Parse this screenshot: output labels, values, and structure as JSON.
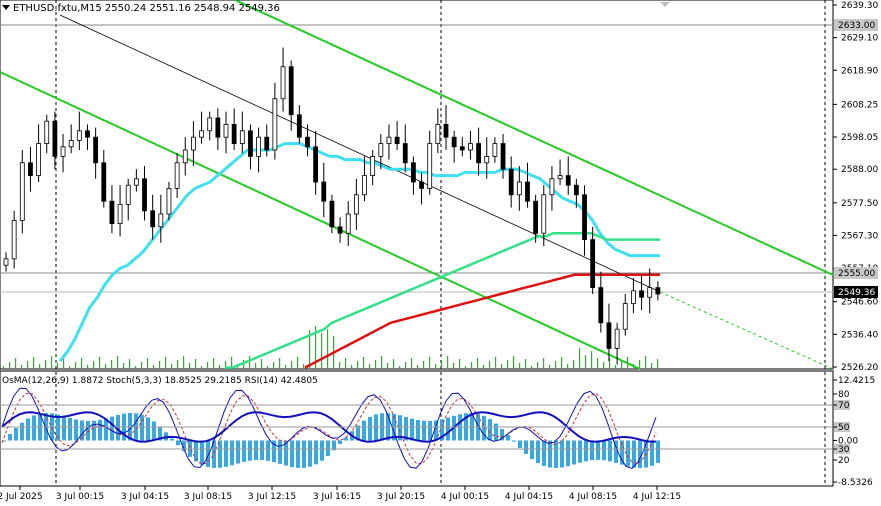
{
  "chart": {
    "symbol": "ETHUSD.fxtu,M15",
    "ohlc": "2550.24 2551.16 2548.94 2549.36",
    "bid_price": "2549.36",
    "level_price": "2555.00",
    "high_level_price": "2633.00",
    "colors": {
      "ema_fast": "#3fe0f0",
      "ema_mid": "#33e08a",
      "ema_slow": "#e01010",
      "channel": "#22cc22",
      "trend": "#000000",
      "candle": "#000000",
      "osma": "#39a8e0",
      "stoch_main": "#1010c0",
      "stoch_signal": "#d03030",
      "rsi": "#1010c0"
    }
  },
  "indicator": {
    "label": "OsMA(12,26,9) 1.8872  Stoch(5,3,3) 18.8525 29.2185  RSI(14) 42.4805"
  },
  "chart_data": [
    {
      "type": "line",
      "title": "ETHUSD.fxtu,M15",
      "xlabel": "",
      "ylabel": "",
      "y_ticks": [
        "2639.30",
        "2629.10",
        "2618.90",
        "2608.25",
        "2598.05",
        "2588.00",
        "2577.50",
        "2567.30",
        "2557.10",
        "2546.60",
        "2536.40",
        "2526.20"
      ],
      "x_ticks": [
        "2 Jul 2025",
        "3 Jul 00:15",
        "3 Jul 04:15",
        "3 Jul 08:15",
        "3 Jul 12:15",
        "3 Jul 16:15",
        "3 Jul 20:15",
        "4 Jul 00:15",
        "4 Jul 04:15",
        "4 Jul 08:15",
        "4 Jul 12:15"
      ],
      "ylim": [
        2526.2,
        2639.3
      ],
      "close": [
        2560,
        2572,
        2590,
        2586,
        2596,
        2603,
        2592,
        2595,
        2597,
        2600,
        2598,
        2590,
        2578,
        2571,
        2577,
        2583,
        2585,
        2575,
        2570,
        2574,
        2582,
        2590,
        2594,
        2598,
        2600,
        2604,
        2598,
        2602,
        2596,
        2600,
        2592,
        2598,
        2594,
        2610,
        2620,
        2605,
        2598,
        2595,
        2584,
        2578,
        2570,
        2568,
        2574,
        2580,
        2586,
        2592,
        2596,
        2598,
        2596,
        2590,
        2584,
        2582,
        2596,
        2602,
        2598,
        2595,
        2594,
        2596,
        2590,
        2592,
        2596,
        2588,
        2580,
        2584,
        2578,
        2568,
        2580,
        2585,
        2586,
        2583,
        2580,
        2566,
        2551,
        2540,
        2532,
        2538,
        2546,
        2550,
        2548,
        2551,
        2549
      ],
      "ema_fast": [
        2528,
        2531,
        2535,
        2540,
        2545,
        2548,
        2552,
        2555,
        2557,
        2558,
        2560,
        2562,
        2565,
        2568,
        2571,
        2574,
        2577,
        2580,
        2582,
        2583,
        2584,
        2586,
        2588,
        2590,
        2592,
        2594,
        2594,
        2594,
        2594,
        2595,
        2596,
        2596,
        2596,
        2595,
        2594,
        2593,
        2592,
        2592,
        2591,
        2591,
        2591,
        2590,
        2590,
        2589,
        2588,
        2588,
        2588,
        2588,
        2587,
        2587,
        2586,
        2586,
        2586,
        2586,
        2587,
        2587,
        2587,
        2587,
        2587,
        2588,
        2588,
        2588,
        2587,
        2586,
        2585,
        2583,
        2581,
        2579,
        2578,
        2577,
        2575,
        2572,
        2568,
        2565,
        2563,
        2562,
        2561,
        2561,
        2561,
        2561,
        2561
      ],
      "ema_mid": [
        2526,
        2526,
        2527,
        2528,
        2529,
        2530,
        2531,
        2532,
        2533,
        2534,
        2535,
        2536,
        2537,
        2538,
        2540,
        2541,
        2542,
        2543,
        2544,
        2545,
        2546,
        2547,
        2548,
        2549,
        2550,
        2551,
        2552,
        2553,
        2554,
        2555,
        2556,
        2557,
        2558,
        2559,
        2560,
        2561,
        2562,
        2563,
        2564,
        2565,
        2566,
        2567,
        2567,
        2568,
        2568,
        2568,
        2568,
        2568,
        2568,
        2567,
        2566,
        2566,
        2566,
        2566,
        2566,
        2566,
        2566,
        2566
      ],
      "ema_slow": [
        2526,
        2528,
        2530,
        2532,
        2534,
        2536,
        2538,
        2540,
        2541,
        2542,
        2543,
        2544,
        2545,
        2546,
        2547,
        2548,
        2549,
        2550,
        2551,
        2552,
        2553,
        2554,
        2555,
        2555,
        2555,
        2555,
        2555,
        2555,
        2555,
        2555
      ]
    },
    {
      "type": "line",
      "title": "",
      "series": [
        {
          "name": "OsMA(12,26,9)",
          "last": 1.8872
        },
        {
          "name": "Stoch(5,3,3) main",
          "last": 18.8525
        },
        {
          "name": "Stoch(5,3,3) signal",
          "last": 29.2185
        },
        {
          "name": "RSI(14)",
          "last": 42.4805
        }
      ],
      "y_ticks": [
        "12.4215",
        "80",
        "70",
        "50",
        "0.00",
        "30",
        "20",
        "-8.5326"
      ],
      "ylim": [
        -8.5326,
        12.4215
      ]
    }
  ]
}
